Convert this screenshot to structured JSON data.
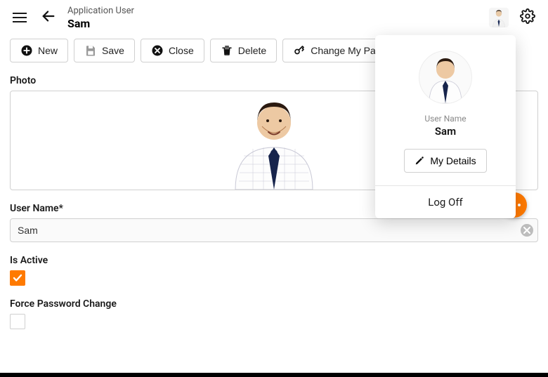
{
  "header": {
    "breadcrumb": "Application User",
    "title": "Sam"
  },
  "toolbar": {
    "new_label": "New",
    "save_label": "Save",
    "close_label": "Close",
    "delete_label": "Delete",
    "change_pw_label": "Change My Pass"
  },
  "form": {
    "photo_label": "Photo",
    "username_label": "User Name*",
    "username_value": "Sam",
    "is_active_label": "Is Active",
    "is_active_checked": true,
    "force_pw_label": "Force Password Change",
    "force_pw_checked": false
  },
  "popover": {
    "username_caption": "User Name",
    "username": "Sam",
    "my_details_label": "My Details",
    "logoff_label": "Log Off"
  },
  "colors": {
    "accent": "#ff7a00"
  }
}
